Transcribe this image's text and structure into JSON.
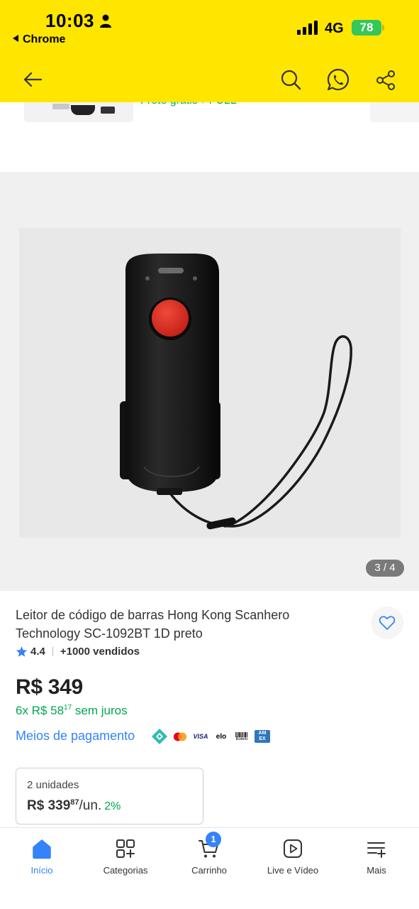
{
  "status_bar": {
    "time": "10:03",
    "back_app": "Chrome",
    "network": "4G",
    "battery": "78"
  },
  "header": {
    "back_icon": "arrow-left-icon",
    "search_icon": "search-icon",
    "whatsapp_icon": "whatsapp-icon",
    "share_icon": "share-icon",
    "background_color": "#ffe600"
  },
  "previous_card": {
    "shipping_text": "Frete grátis ⚡FULL"
  },
  "gallery": {
    "counter": "3 / 4"
  },
  "product": {
    "title": "Leitor de código de barras Hong Kong Scanhero Technology SC-1092BT 1D preto",
    "rating": "4.4",
    "sold": "+1000 vendidos",
    "price": "R$ 349",
    "installments_prefix": "6x R$ 58",
    "installments_cents": "17",
    "installments_suffix": "sem juros",
    "payment_link": "Meios de pagamento",
    "payment_icons": [
      "pix-icon",
      "mastercard-icon",
      "visa-icon",
      "elo-icon",
      "boleto-icon",
      "amex-icon"
    ],
    "payment_labels": {
      "visa": "VISA",
      "elo": "elo",
      "boleto": "Boleto",
      "amex": "AM EX"
    }
  },
  "units_offer": {
    "label": "2 unidades",
    "price_main": "R$ 339",
    "price_cents": "87",
    "price_suffix": "/un.",
    "discount": "2%"
  },
  "bottom_nav": {
    "items": [
      {
        "label": "Início",
        "icon": "home-icon",
        "active": true
      },
      {
        "label": "Categorias",
        "icon": "categories-icon",
        "active": false
      },
      {
        "label": "Carrinho",
        "icon": "cart-icon",
        "active": false
      },
      {
        "label": "Live e Vídeo",
        "icon": "play-icon",
        "active": false
      },
      {
        "label": "Mais",
        "icon": "menu-plus-icon",
        "active": false
      }
    ],
    "cart_count": "1"
  },
  "colors": {
    "accent": "#3483fa",
    "green": "#00a650",
    "header": "#ffe600"
  }
}
